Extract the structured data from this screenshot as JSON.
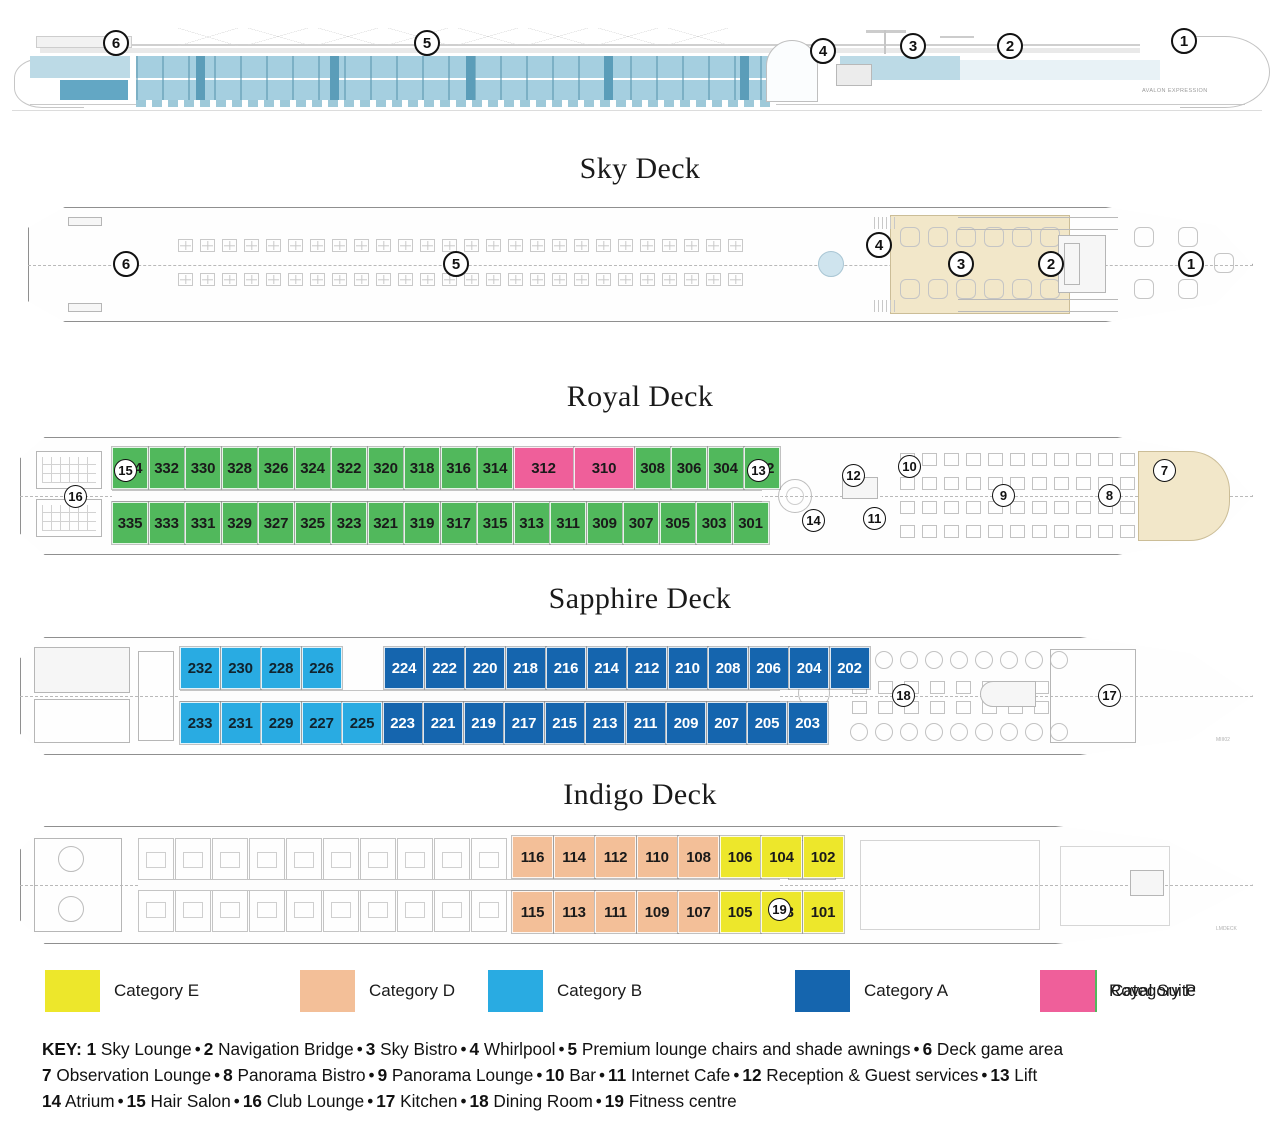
{
  "ship": {
    "name": "AVALON EXPRESSION"
  },
  "decks": [
    {
      "id": "elevation",
      "title": "Sky Deck",
      "markers": [
        6,
        5,
        4,
        3,
        2,
        1
      ]
    },
    {
      "id": "royal",
      "title": "Royal Deck",
      "markers": [
        6,
        5,
        4,
        3,
        2,
        1
      ]
    },
    {
      "id": "sapphire",
      "title": "Sapphire Deck",
      "markers": [
        15,
        16,
        13,
        14,
        12,
        11,
        10,
        9,
        8,
        7
      ]
    },
    {
      "id": "indigo",
      "title": "Indigo Deck",
      "markers": [
        18,
        17
      ]
    },
    {
      "id": "lower",
      "title": "",
      "markers": [
        19
      ]
    }
  ],
  "deck_titles": {
    "sky": "Sky Deck",
    "royal": "Royal Deck",
    "sapphire": "Sapphire Deck",
    "indigo": "Indigo Deck"
  },
  "cabins": {
    "sapphire_upper": [
      {
        "n": "334",
        "cat": "P"
      },
      {
        "n": "332",
        "cat": "P"
      },
      {
        "n": "330",
        "cat": "P"
      },
      {
        "n": "328",
        "cat": "P"
      },
      {
        "n": "326",
        "cat": "P"
      },
      {
        "n": "324",
        "cat": "P"
      },
      {
        "n": "322",
        "cat": "P"
      },
      {
        "n": "320",
        "cat": "P"
      },
      {
        "n": "318",
        "cat": "P"
      },
      {
        "n": "316",
        "cat": "P"
      },
      {
        "n": "314",
        "cat": "P"
      },
      {
        "n": "312",
        "cat": "RS"
      },
      {
        "n": "310",
        "cat": "RS"
      },
      {
        "n": "308",
        "cat": "P"
      },
      {
        "n": "306",
        "cat": "P"
      },
      {
        "n": "304",
        "cat": "P"
      },
      {
        "n": "302",
        "cat": "P"
      }
    ],
    "sapphire_lower": [
      {
        "n": "335",
        "cat": "P"
      },
      {
        "n": "333",
        "cat": "P"
      },
      {
        "n": "331",
        "cat": "P"
      },
      {
        "n": "329",
        "cat": "P"
      },
      {
        "n": "327",
        "cat": "P"
      },
      {
        "n": "325",
        "cat": "P"
      },
      {
        "n": "323",
        "cat": "P"
      },
      {
        "n": "321",
        "cat": "P"
      },
      {
        "n": "319",
        "cat": "P"
      },
      {
        "n": "317",
        "cat": "P"
      },
      {
        "n": "315",
        "cat": "P"
      },
      {
        "n": "313",
        "cat": "P"
      },
      {
        "n": "311",
        "cat": "P"
      },
      {
        "n": "309",
        "cat": "P"
      },
      {
        "n": "307",
        "cat": "P"
      },
      {
        "n": "305",
        "cat": "P"
      },
      {
        "n": "303",
        "cat": "P"
      },
      {
        "n": "301",
        "cat": "P"
      }
    ],
    "indigo_upper": [
      {
        "n": "232",
        "cat": "B"
      },
      {
        "n": "230",
        "cat": "B"
      },
      {
        "n": "228",
        "cat": "B"
      },
      {
        "n": "226",
        "cat": "B"
      },
      {
        "n": "224",
        "cat": "A"
      },
      {
        "n": "222",
        "cat": "A"
      },
      {
        "n": "220",
        "cat": "A"
      },
      {
        "n": "218",
        "cat": "A"
      },
      {
        "n": "216",
        "cat": "A"
      },
      {
        "n": "214",
        "cat": "A"
      },
      {
        "n": "212",
        "cat": "A"
      },
      {
        "n": "210",
        "cat": "A"
      },
      {
        "n": "208",
        "cat": "A"
      },
      {
        "n": "206",
        "cat": "A"
      },
      {
        "n": "204",
        "cat": "A"
      },
      {
        "n": "202",
        "cat": "A"
      }
    ],
    "indigo_lower": [
      {
        "n": "233",
        "cat": "B"
      },
      {
        "n": "231",
        "cat": "B"
      },
      {
        "n": "229",
        "cat": "B"
      },
      {
        "n": "227",
        "cat": "B"
      },
      {
        "n": "225",
        "cat": "B"
      },
      {
        "n": "223",
        "cat": "A"
      },
      {
        "n": "221",
        "cat": "A"
      },
      {
        "n": "219",
        "cat": "A"
      },
      {
        "n": "217",
        "cat": "A"
      },
      {
        "n": "215",
        "cat": "A"
      },
      {
        "n": "213",
        "cat": "A"
      },
      {
        "n": "211",
        "cat": "A"
      },
      {
        "n": "209",
        "cat": "A"
      },
      {
        "n": "207",
        "cat": "A"
      },
      {
        "n": "205",
        "cat": "A"
      },
      {
        "n": "203",
        "cat": "A"
      }
    ],
    "lower_upper": [
      {
        "n": "116",
        "cat": "D"
      },
      {
        "n": "114",
        "cat": "D"
      },
      {
        "n": "112",
        "cat": "D"
      },
      {
        "n": "110",
        "cat": "D"
      },
      {
        "n": "108",
        "cat": "D"
      },
      {
        "n": "106",
        "cat": "E"
      },
      {
        "n": "104",
        "cat": "E"
      },
      {
        "n": "102",
        "cat": "E"
      }
    ],
    "lower_lower": [
      {
        "n": "115",
        "cat": "D"
      },
      {
        "n": "113",
        "cat": "D"
      },
      {
        "n": "111",
        "cat": "D"
      },
      {
        "n": "109",
        "cat": "D"
      },
      {
        "n": "107",
        "cat": "D"
      },
      {
        "n": "105",
        "cat": "E"
      },
      {
        "n": "103",
        "cat": "E"
      },
      {
        "n": "101",
        "cat": "E"
      }
    ]
  },
  "legend": [
    {
      "label": "Category E",
      "color": "#ede72b"
    },
    {
      "label": "Category D",
      "color": "#f3bf98"
    },
    {
      "label": "Category B",
      "color": "#29abe2"
    },
    {
      "label": "Category A",
      "color": "#1565ae"
    },
    {
      "label": "Category P",
      "color": "#51b85c"
    },
    {
      "label": "Royal Suite",
      "color": "#ef5f9a"
    }
  ],
  "key": {
    "prefix": "KEY:",
    "lines": [
      [
        {
          "num": "1",
          "name": "Sky Lounge"
        },
        {
          "num": "2",
          "name": "Navigation Bridge"
        },
        {
          "num": "3",
          "name": "Sky Bistro"
        },
        {
          "num": "4",
          "name": "Whirlpool"
        },
        {
          "num": "5",
          "name": "Premium lounge chairs and shade awnings"
        },
        {
          "num": "6",
          "name": "Deck game area"
        }
      ],
      [
        {
          "num": "7",
          "name": "Observation Lounge"
        },
        {
          "num": "8",
          "name": "Panorama Bistro"
        },
        {
          "num": "9",
          "name": "Panorama Lounge"
        },
        {
          "num": "10",
          "name": "Bar"
        },
        {
          "num": "11",
          "name": "Internet Cafe"
        },
        {
          "num": "12",
          "name": "Reception & Guest services"
        },
        {
          "num": "13",
          "name": "Lift"
        }
      ],
      [
        {
          "num": "14",
          "name": "Atrium"
        },
        {
          "num": "15",
          "name": "Hair Salon"
        },
        {
          "num": "16",
          "name": "Club Lounge"
        },
        {
          "num": "17",
          "name": "Kitchen"
        },
        {
          "num": "18",
          "name": "Dining Room"
        },
        {
          "num": "19",
          "name": "Fitness centre"
        }
      ]
    ]
  }
}
